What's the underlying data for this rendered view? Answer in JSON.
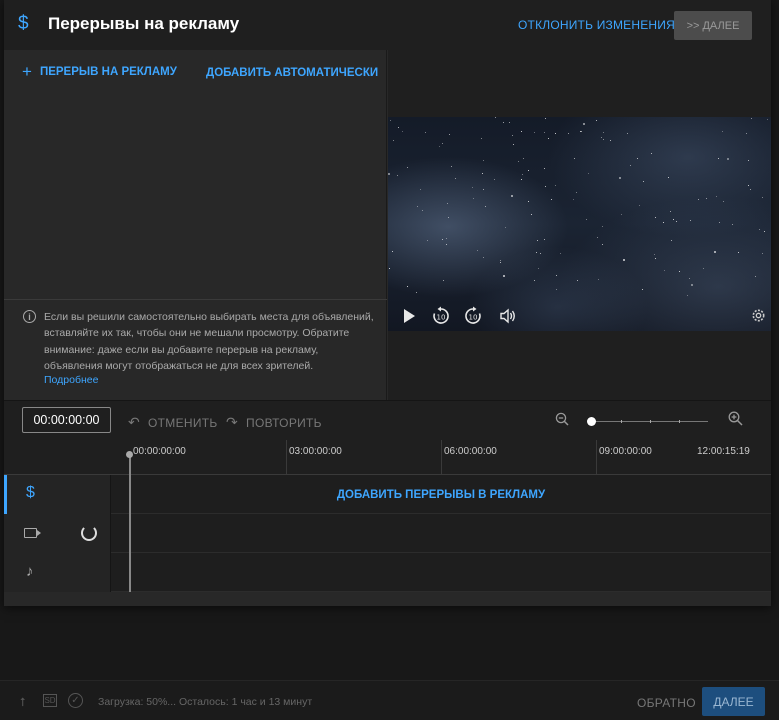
{
  "header": {
    "icon": "dollar-icon",
    "title": "Перерывы на рекламу",
    "discard_label": "ОТКЛОНИТЬ ИЗМЕНЕНИЯ",
    "next_label": ">> ДАЛЕЕ"
  },
  "left_panel": {
    "add_break_label": "ПЕРЕРЫВ НА РЕКЛАМУ",
    "add_auto_label": "ДОБАВИТЬ АВТОМАТИЧЕСКИ",
    "info_text": "Если вы решили самостоятельно выбирать места для объявлений, вставляйте их так, чтобы они не мешали просмотру. Обратите внимание: даже если вы добавите перерыв на рекламу, объявления могут отображаться не для всех зрителей.",
    "info_link": "Подробнее"
  },
  "toolbar": {
    "timecode": "00:00:00:00",
    "undo_label": "ОТМЕНИТЬ",
    "redo_label": "ПОВТОРИТЬ",
    "zoom_level": 0
  },
  "ruler": {
    "labels": [
      "00:00:00:00",
      "03:00:00:00",
      "06:00:00:00",
      "09:00:00:00",
      "12:00:15:19"
    ]
  },
  "tracks": {
    "ads_add_label": "ДОБАВИТЬ ПЕРЕРЫВЫ В РЕКЛАМУ"
  },
  "bottom": {
    "hd_badge": "SD",
    "upload_status": "Загрузка: 50%... Осталось: 1 час и 13 минут",
    "back_label": "ОБРАТНО",
    "done_label": "ДАЛЕЕ"
  },
  "colors": {
    "accent": "#3ea6ff",
    "background": "#181818",
    "panel": "#282828"
  }
}
